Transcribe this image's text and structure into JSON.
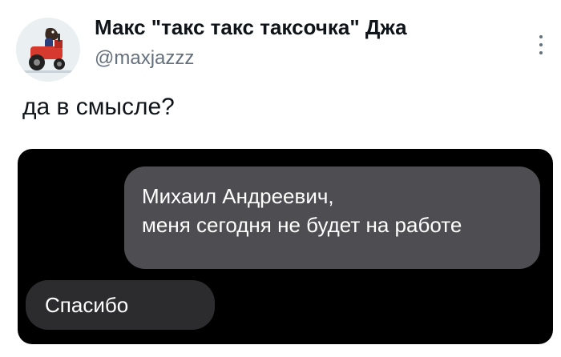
{
  "author": {
    "name": "Макс \"такс такс таксочка\" Джа",
    "handle": "@maxjazzz",
    "avatar_icon": "tractor-dog-avatar"
  },
  "tweet": {
    "text": "да в смысле?"
  },
  "media": {
    "messages": [
      {
        "direction": "outgoing",
        "lines": [
          "Михаил Андреевич,",
          "меня сегодня не будет на работе"
        ]
      },
      {
        "direction": "incoming",
        "text": "Спасибо"
      }
    ]
  },
  "colors": {
    "background": "#ffffff",
    "text": "#0f1419",
    "secondary_text": "#64707b",
    "media_background": "#000000",
    "outgoing_bubble": "#4e4e52",
    "incoming_bubble": "#2c2c2e"
  }
}
